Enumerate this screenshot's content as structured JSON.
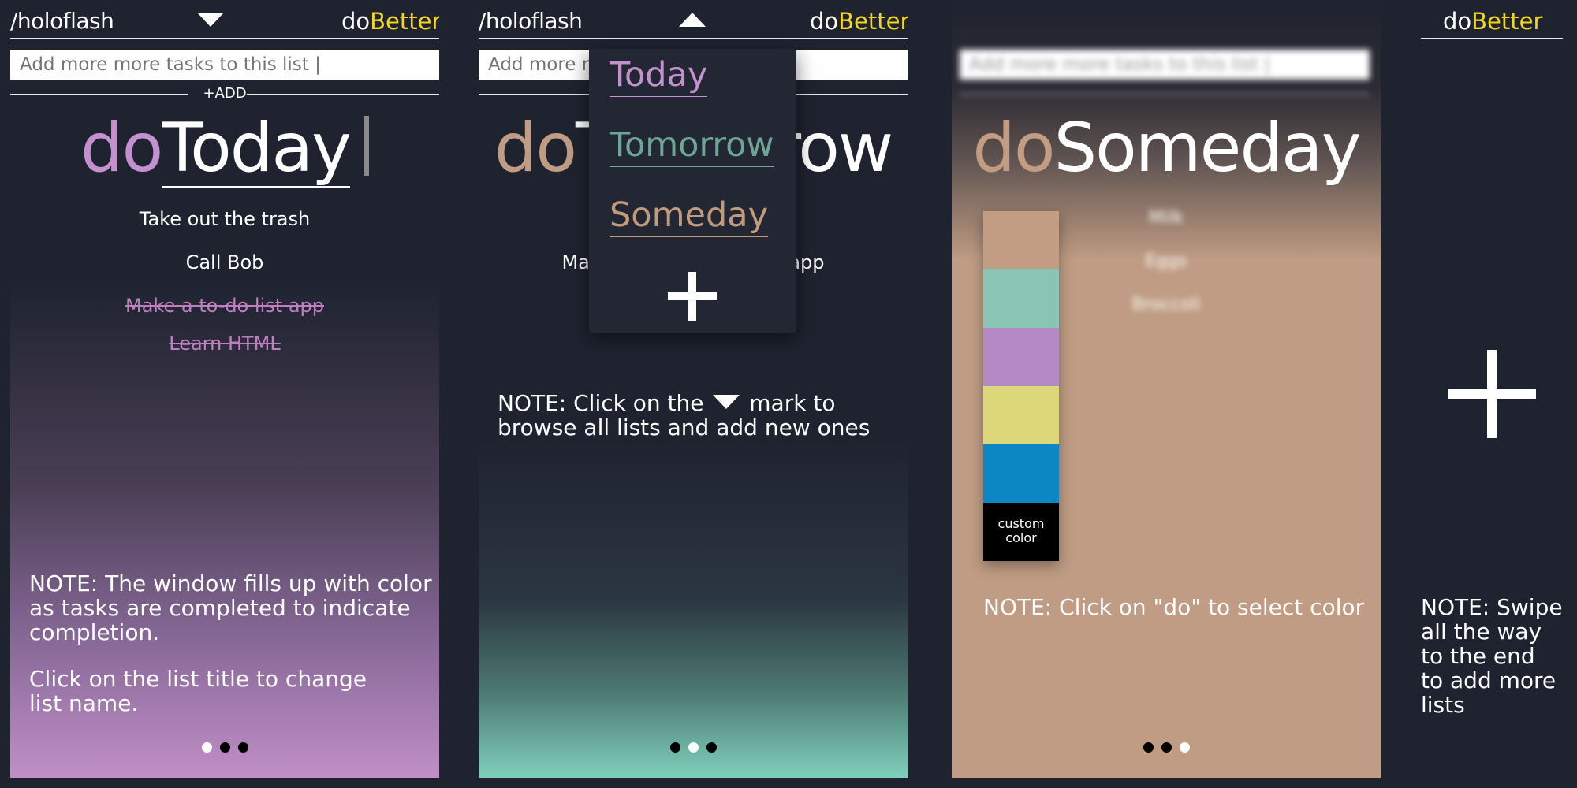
{
  "header": {
    "username": "/holoflash",
    "brand_prefix": "do",
    "brand_suffix": "Better"
  },
  "input": {
    "placeholder": "Add more more tasks to this list |",
    "add_label": "+ADD"
  },
  "panels": [
    {
      "title_prefix": "do",
      "title_name": "Today",
      "title_prefix_color": "#c391cf",
      "tasks": [
        {
          "text": "Take out the trash",
          "done": false
        },
        {
          "text": "Call Bob",
          "done": false
        },
        {
          "text": "Make a to-do list app",
          "done": true
        },
        {
          "text": "Learn HTML",
          "done": true
        }
      ],
      "note_lines": [
        "NOTE: The window fills up with color",
        "as tasks are completed to indicate",
        "completion."
      ],
      "note2_lines": [
        "Click on the list title to change",
        "list name."
      ],
      "page_indicator": {
        "count": 3,
        "active": 1
      }
    },
    {
      "title_prefix": "do",
      "title_name": "Tomorrow",
      "title_prefix_color": "#bf9c83",
      "tasks": [
        {
          "text": "Make a better to-do list app",
          "done": false
        }
      ],
      "note_line1_a": "NOTE: Click on the",
      "note_line1_b": "mark to",
      "note_line2": "browse all lists and add new ones",
      "dropdown": [
        {
          "label": "Today",
          "color": "#c391cf"
        },
        {
          "label": "Tomorrow",
          "color": "#6ea696"
        },
        {
          "label": "Someday",
          "color": "#c29a7c"
        }
      ],
      "page_indicator": {
        "count": 3,
        "active": 2
      }
    },
    {
      "title_prefix": "do",
      "title_name": "Someday",
      "title_prefix_color": "#c29c83",
      "tasks": [
        {
          "text": "Milk"
        },
        {
          "text": "Eggs"
        },
        {
          "text": "Broccoli"
        }
      ],
      "swatches": [
        "#c29c83",
        "#8ac4b4",
        "#b589c4",
        "#ddd87a",
        "#0d86c4"
      ],
      "custom_color_lines": [
        "custom",
        "color"
      ],
      "note": "NOTE: Click on \"do\" to select color",
      "page_indicator": {
        "count": 3,
        "active": 3
      }
    },
    {
      "note_lines": [
        "NOTE: Swipe",
        "all the way",
        "to the end",
        "to add more",
        "lists"
      ]
    }
  ]
}
